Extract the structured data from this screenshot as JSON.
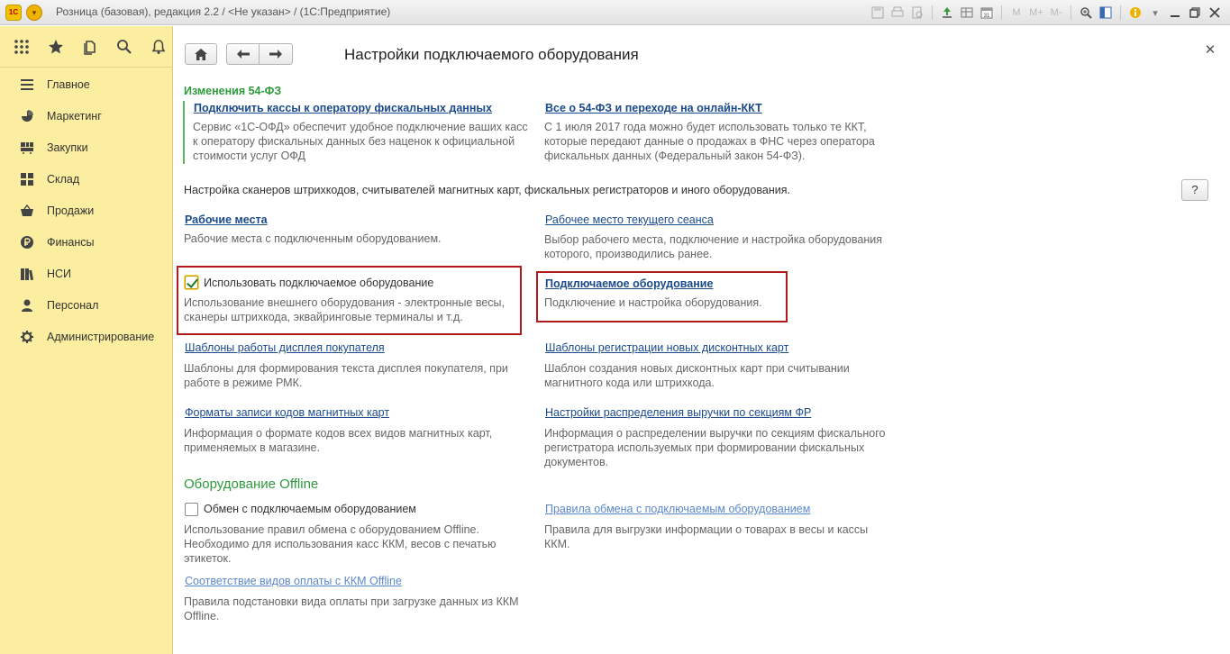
{
  "titlebar": {
    "logo": "1С",
    "title": "Розница (базовая), редакция 2.2 / <Не указан> / (1С:Предприятие)",
    "icons": [
      "save-icon",
      "print-icon",
      "preview-icon",
      "upload-icon",
      "table-icon",
      "calendar-icon",
      "m-icon",
      "m-plus-icon",
      "m-minus-icon",
      "zoom-icon",
      "panel-icon",
      "info-icon",
      "dropdown-icon",
      "minimize-icon",
      "restore-icon",
      "close-icon"
    ],
    "calendar_day": "31",
    "m_labels": [
      "M",
      "M+",
      "M-"
    ]
  },
  "leftpanel": {
    "toolbar_icons": [
      "apps-icon",
      "star-icon",
      "history-icon",
      "search-icon",
      "bell-icon"
    ],
    "nav": [
      {
        "icon": "menu-lines-icon",
        "label": "Главное"
      },
      {
        "icon": "marketing-icon",
        "label": "Маркетинг"
      },
      {
        "icon": "cart-icon",
        "label": "Закупки"
      },
      {
        "icon": "warehouse-icon",
        "label": "Склад"
      },
      {
        "icon": "basket-icon",
        "label": "Продажи"
      },
      {
        "icon": "ruble-icon",
        "label": "Финансы"
      },
      {
        "icon": "books-icon",
        "label": "НСИ"
      },
      {
        "icon": "person-icon",
        "label": "Персонал"
      },
      {
        "icon": "gear-icon",
        "label": "Администрирование"
      }
    ]
  },
  "main": {
    "title": "Настройки подключаемого оборудования",
    "section_54fz": {
      "heading": "Изменения 54-ФЗ",
      "left_link": "Подключить кассы к оператору фискальных данных",
      "left_desc": "Сервис «1С-ОФД» обеспечит удобное подключение ваших касс к оператору фискальных данных без наценок к официальной стоимости услуг ОФД",
      "right_link": "Все о 54-ФЗ и переходе на онлайн-ККТ",
      "right_desc": "С 1 июля 2017 года можно будет использовать только те ККТ, которые передают данные о продажах в ФНС через оператора фискальных данных (Федеральный закон 54-ФЗ)."
    },
    "intro": "Настройка сканеров штрихкодов, считывателей магнитных карт, фискальных регистраторов и иного оборудования.",
    "help_label": "?",
    "items": {
      "workplaces_link": "Рабочие места",
      "workplaces_desc": "Рабочие места с подключенным оборудованием.",
      "current_workplace_link": "Рабочее место текущего сеанса",
      "current_workplace_desc": "Выбор рабочего места, подключение и настройка оборудования которого, производились ранее.",
      "use_equipment_label": "Использовать подключаемое оборудование",
      "use_equipment_checked": true,
      "use_equipment_desc": "Использование внешнего оборудования - электронные весы, сканеры штрихкода, эквайринговые терминалы и т.д.",
      "equipment_link": "Подключаемое оборудование",
      "equipment_desc": "Подключение и настройка оборудования.",
      "display_templates_link": "Шаблоны работы дисплея покупателя",
      "display_templates_desc": "Шаблоны для формирования текста дисплея покупателя, при работе в режиме РМК.",
      "card_templates_link": "Шаблоны регистрации новых дисконтных карт",
      "card_templates_desc": "Шаблон создания новых дисконтных карт при считывании магнитного кода или штрихкода.",
      "magnetic_formats_link": "Форматы записи кодов магнитных карт",
      "magnetic_formats_desc": "Информация о формате кодов всех видов магнитных карт, применяемых в магазине.",
      "revenue_link": "Настройки распределения выручки по секциям ФР",
      "revenue_desc": "Информация о распределении выручки по секциям фискального регистратора используемых при формировании фискальных документов."
    },
    "offline": {
      "heading": "Оборудование Offline",
      "exchange_label": "Обмен с подключаемым оборудованием",
      "exchange_checked": false,
      "exchange_desc": "Использование правил обмена с оборудованием Offline. Необходимо для использования касс ККМ, весов с печатью этикеток.",
      "rules_link": "Правила обмена с подключаемым оборудованием",
      "rules_desc": "Правила для выгрузки информации о товарах в весы и кассы ККМ.",
      "payment_link": "Соответствие видов оплаты с ККМ Offline",
      "payment_desc": "Правила подстановки вида оплаты при загрузке данных из ККМ Offline."
    }
  }
}
